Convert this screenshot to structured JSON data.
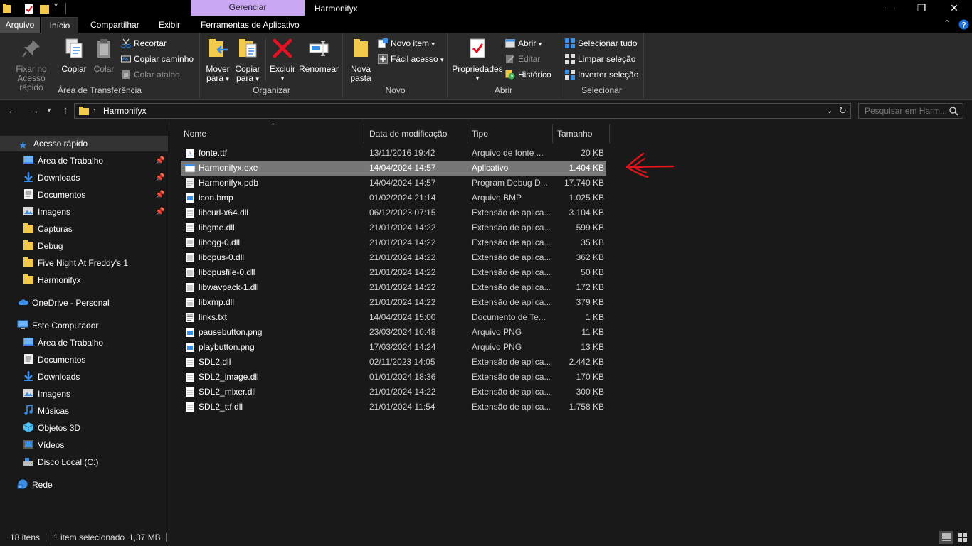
{
  "window": {
    "title": "Harmonifyx",
    "context_tab": "Gerenciar",
    "controls": {
      "minimize": "—",
      "maximize": "❐",
      "close": "✕"
    }
  },
  "ribbon_tabs": [
    "Arquivo",
    "Início",
    "Compartilhar",
    "Exibir",
    "Ferramentas de Aplicativo"
  ],
  "ribbon": {
    "clipboard": {
      "label": "Área de Transferência",
      "pin": "Fixar no\nAcesso rápido",
      "pin_line1": "Fixar no",
      "pin_line2": "Acesso rápido",
      "copy": "Copiar",
      "paste": "Colar",
      "cut": "Recortar",
      "copy_path": "Copiar caminho",
      "paste_shortcut": "Colar atalho"
    },
    "organize": {
      "label": "Organizar",
      "move_line1": "Mover",
      "move_line2": "para",
      "copy_line1": "Copiar",
      "copy_line2": "para",
      "delete": "Excluir",
      "rename": "Renomear"
    },
    "new": {
      "label": "Novo",
      "new_folder_line1": "Nova",
      "new_folder_line2": "pasta",
      "new_item": "Novo item",
      "easy_access": "Fácil acesso"
    },
    "open": {
      "label": "Abrir",
      "properties": "Propriedades",
      "open": "Abrir",
      "edit": "Editar",
      "history": "Histórico"
    },
    "select": {
      "label": "Selecionar",
      "select_all": "Selecionar tudo",
      "select_none": "Limpar seleção",
      "invert": "Inverter seleção"
    }
  },
  "address": {
    "path": "Harmonifyx",
    "search_placeholder": "Pesquisar em Harm..."
  },
  "sidebar": {
    "quick_access": "Acesso rápido",
    "quick_items": [
      {
        "label": "Área de Trabalho",
        "pinned": true
      },
      {
        "label": "Downloads",
        "pinned": true
      },
      {
        "label": "Documentos",
        "pinned": true
      },
      {
        "label": "Imagens",
        "pinned": true
      },
      {
        "label": "Capturas",
        "pinned": false
      },
      {
        "label": "Debug",
        "pinned": false
      },
      {
        "label": "Five Night At Freddy's 1",
        "pinned": false
      },
      {
        "label": "Harmonifyx",
        "pinned": false
      }
    ],
    "onedrive": "OneDrive - Personal",
    "this_pc": "Este Computador",
    "pc_items": [
      "Área de Trabalho",
      "Documentos",
      "Downloads",
      "Imagens",
      "Músicas",
      "Objetos 3D",
      "Vídeos",
      "Disco Local (C:)"
    ],
    "network": "Rede"
  },
  "columns": {
    "name": "Nome",
    "date": "Data de modificação",
    "type": "Tipo",
    "size": "Tamanho"
  },
  "files": [
    {
      "name": "fonte.ttf",
      "date": "13/11/2016 19:42",
      "type": "Arquivo de fonte ...",
      "size": "20 KB",
      "icon": "font-file-icon"
    },
    {
      "name": "Harmonifyx.exe",
      "date": "14/04/2024 14:57",
      "type": "Aplicativo",
      "size": "1.404 KB",
      "icon": "exe-file-icon",
      "selected": true
    },
    {
      "name": "Harmonifyx.pdb",
      "date": "14/04/2024 14:57",
      "type": "Program Debug D...",
      "size": "17.740 KB",
      "icon": "pdb-file-icon"
    },
    {
      "name": "icon.bmp",
      "date": "01/02/2024 21:14",
      "type": "Arquivo BMP",
      "size": "1.025 KB",
      "icon": "image-file-icon"
    },
    {
      "name": "libcurl-x64.dll",
      "date": "06/12/2023 07:15",
      "type": "Extensão de aplica...",
      "size": "3.104 KB",
      "icon": "dll-file-icon"
    },
    {
      "name": "libgme.dll",
      "date": "21/01/2024 14:22",
      "type": "Extensão de aplica...",
      "size": "599 KB",
      "icon": "dll-file-icon"
    },
    {
      "name": "libogg-0.dll",
      "date": "21/01/2024 14:22",
      "type": "Extensão de aplica...",
      "size": "35 KB",
      "icon": "dll-file-icon"
    },
    {
      "name": "libopus-0.dll",
      "date": "21/01/2024 14:22",
      "type": "Extensão de aplica...",
      "size": "362 KB",
      "icon": "dll-file-icon"
    },
    {
      "name": "libopusfile-0.dll",
      "date": "21/01/2024 14:22",
      "type": "Extensão de aplica...",
      "size": "50 KB",
      "icon": "dll-file-icon"
    },
    {
      "name": "libwavpack-1.dll",
      "date": "21/01/2024 14:22",
      "type": "Extensão de aplica...",
      "size": "172 KB",
      "icon": "dll-file-icon"
    },
    {
      "name": "libxmp.dll",
      "date": "21/01/2024 14:22",
      "type": "Extensão de aplica...",
      "size": "379 KB",
      "icon": "dll-file-icon"
    },
    {
      "name": "links.txt",
      "date": "14/04/2024 15:00",
      "type": "Documento de Te...",
      "size": "1 KB",
      "icon": "text-file-icon"
    },
    {
      "name": "pausebutton.png",
      "date": "23/03/2024 10:48",
      "type": "Arquivo PNG",
      "size": "11 KB",
      "icon": "image-file-icon"
    },
    {
      "name": "playbutton.png",
      "date": "17/03/2024 14:24",
      "type": "Arquivo PNG",
      "size": "13 KB",
      "icon": "image-file-icon"
    },
    {
      "name": "SDL2.dll",
      "date": "02/11/2023 14:05",
      "type": "Extensão de aplica...",
      "size": "2.442 KB",
      "icon": "dll-file-icon"
    },
    {
      "name": "SDL2_image.dll",
      "date": "01/01/2024 18:36",
      "type": "Extensão de aplica...",
      "size": "170 KB",
      "icon": "dll-file-icon"
    },
    {
      "name": "SDL2_mixer.dll",
      "date": "21/01/2024 14:22",
      "type": "Extensão de aplica...",
      "size": "300 KB",
      "icon": "dll-file-icon"
    },
    {
      "name": "SDL2_ttf.dll",
      "date": "21/01/2024 11:54",
      "type": "Extensão de aplica...",
      "size": "1.758 KB",
      "icon": "dll-file-icon"
    }
  ],
  "status": {
    "count": "18 itens",
    "selection": "1 item selecionado",
    "selection_size": "1,37 MB"
  },
  "colors": {
    "annotation_arrow": "#e0141c",
    "selected_row": "#777777",
    "context_tab": "#c9a7f3",
    "folder": "#f3c94c",
    "accent_blue": "#3a8ee6"
  }
}
